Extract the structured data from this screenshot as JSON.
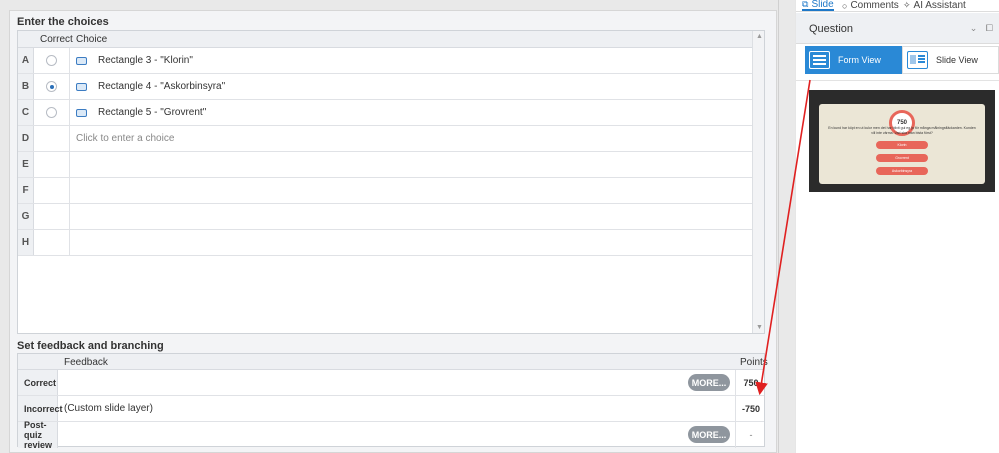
{
  "choices_section": {
    "title": "Enter the choices",
    "col_correct": "Correct",
    "col_choice": "Choice",
    "rows": [
      {
        "letter": "A",
        "text": "Rectangle 3 - \"Klorin\"",
        "selected": false
      },
      {
        "letter": "B",
        "text": "Rectangle 4 - \"Askorbinsyra\"",
        "selected": true
      },
      {
        "letter": "C",
        "text": "Rectangle 5 - \"Grovrent\"",
        "selected": false
      },
      {
        "letter": "D",
        "placeholder": "Click to enter a choice"
      },
      {
        "letter": "E"
      },
      {
        "letter": "F"
      },
      {
        "letter": "G"
      },
      {
        "letter": "H"
      }
    ]
  },
  "feedback_section": {
    "title": "Set feedback and branching",
    "col_feedback": "Feedback",
    "col_points": "Points",
    "more_label": "MORE...",
    "rows": [
      {
        "label": "Correct",
        "feedback": "",
        "points": "750"
      },
      {
        "label": "Incorrect",
        "feedback": "(Custom slide layer)",
        "points": "-750"
      },
      {
        "label": "Post-quiz review",
        "feedback": "",
        "points": "-"
      }
    ]
  },
  "right_panel": {
    "tabs": [
      {
        "label": "Slide",
        "icon": "slide-icon",
        "active": true
      },
      {
        "label": "Comments",
        "icon": "comment-icon",
        "active": false
      },
      {
        "label": "AI Assistant",
        "icon": "sparkle-icon",
        "active": false
      }
    ],
    "header": "Question",
    "form_view_label": "Form View",
    "slide_view_label": "Slide View",
    "thumbnail": {
      "score": "750",
      "question": "En kund har köpt en ut kulor men det har blivit gul eg ja för många målningsfläckarden. Kunden vill inte värma. Vad ska man bista först?",
      "answers": [
        "Klorin",
        "Grovrent",
        "Askorbinsyra"
      ]
    }
  },
  "colors": {
    "accent": "#2a89d6",
    "annotation_arrow": "#e02020",
    "thumb_answer": "#e8665a"
  }
}
